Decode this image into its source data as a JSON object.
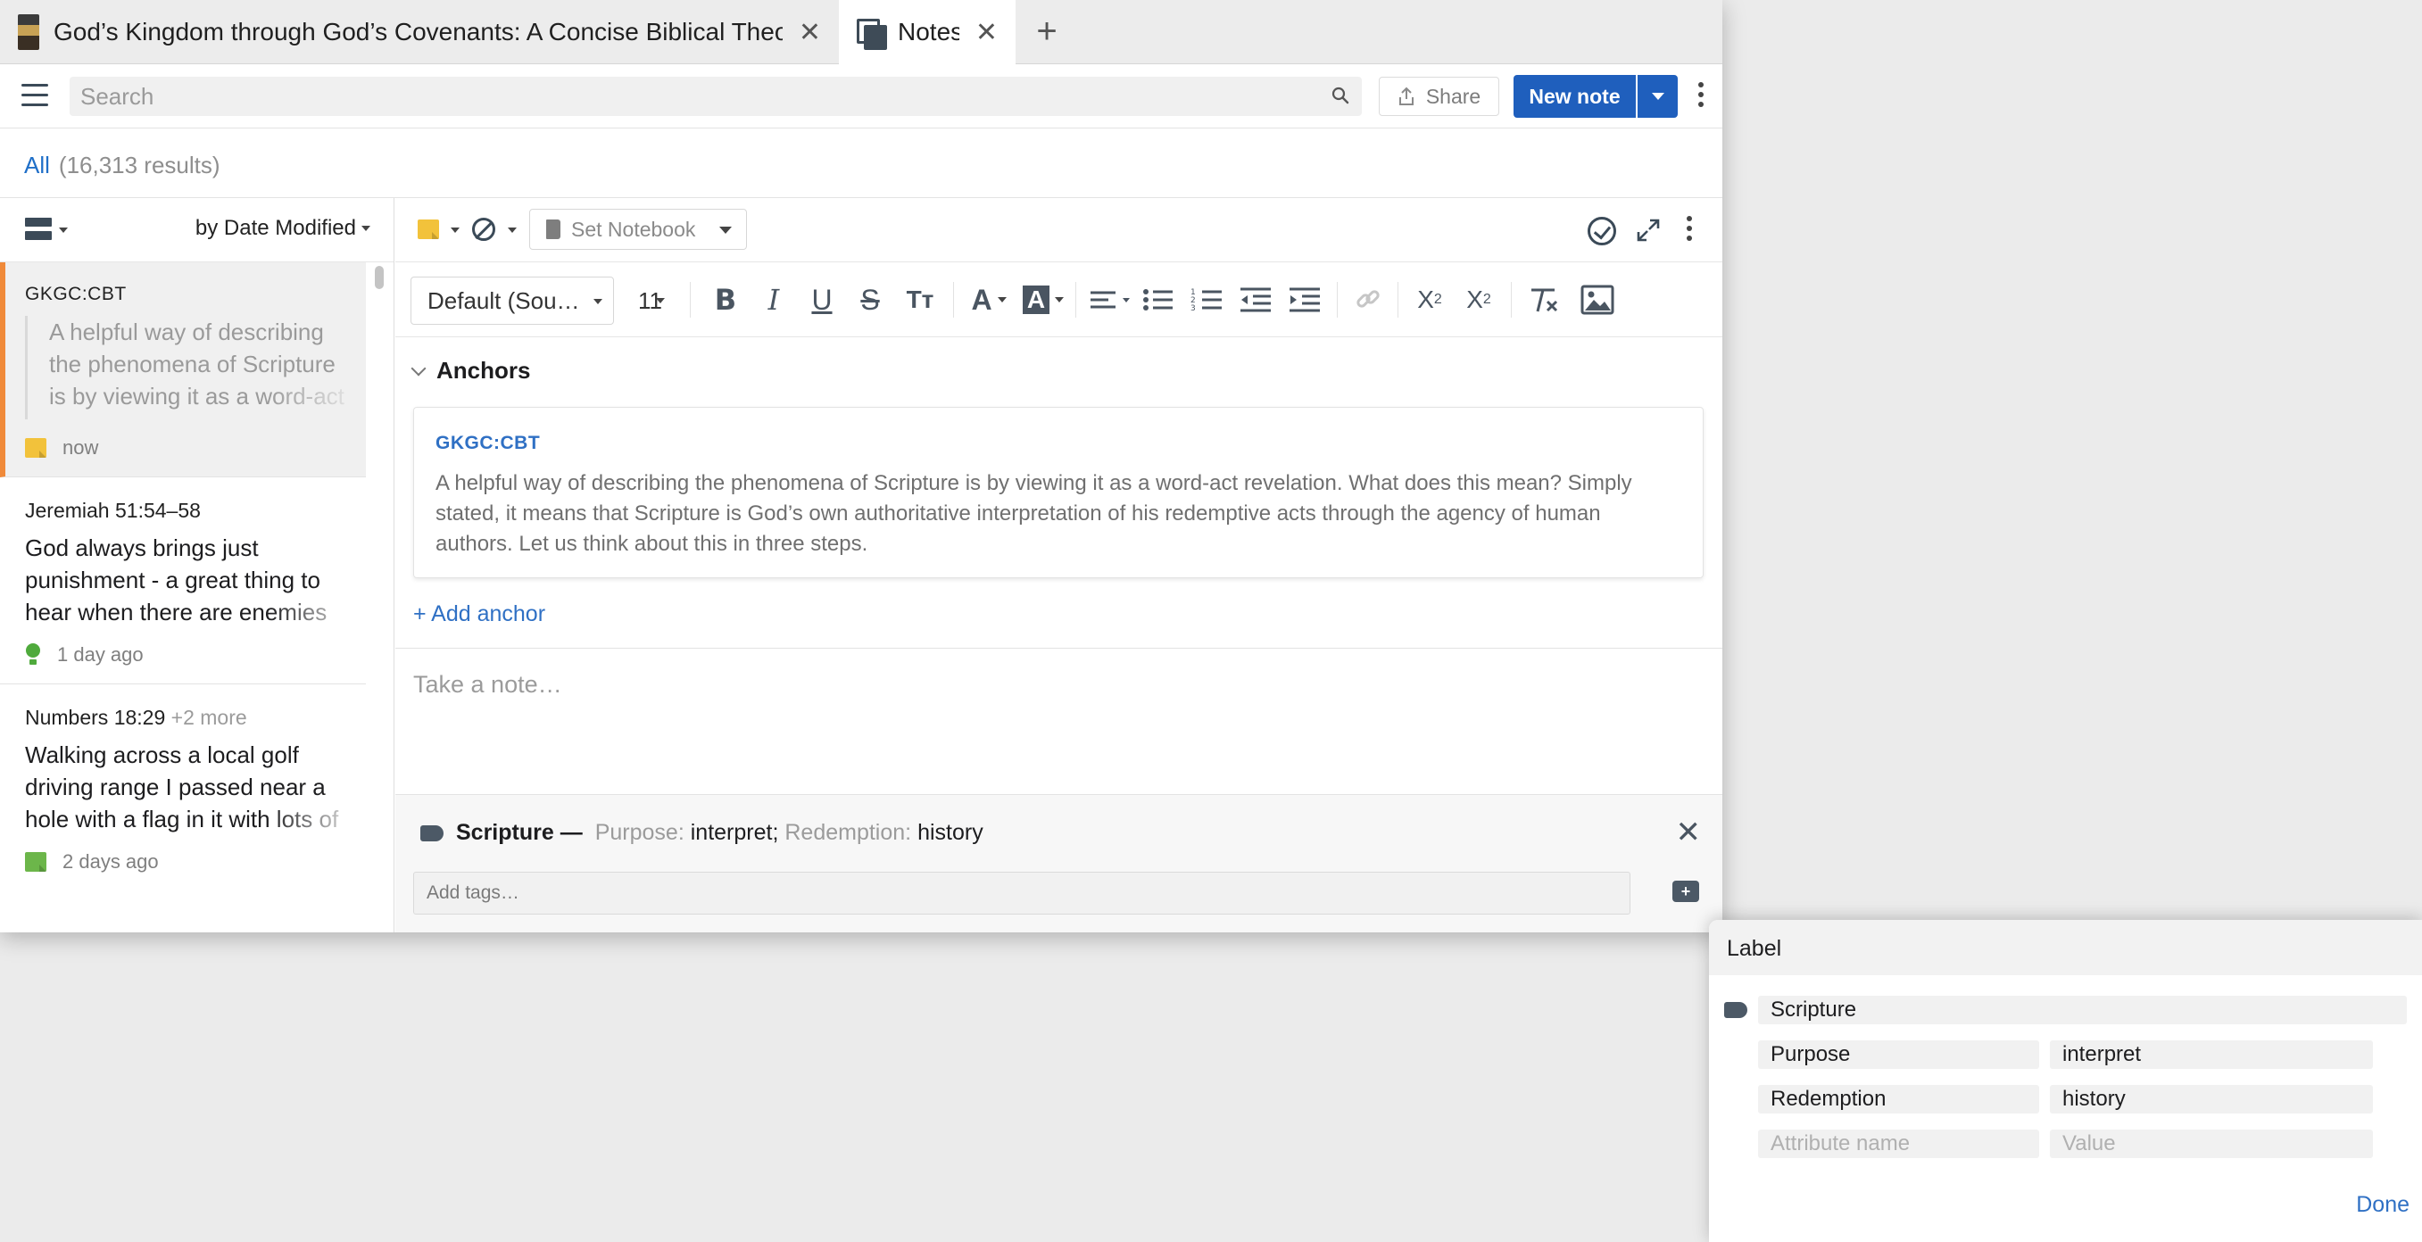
{
  "tabs": [
    {
      "label": "God’s Kingdom through God’s Covenants: A Concise Biblical Theology",
      "close": "✕"
    },
    {
      "label": "Notes",
      "close": "✕"
    }
  ],
  "tab_add": "+",
  "toolbar": {
    "search_placeholder": "Search",
    "share_label": "Share",
    "new_note_label": "New note"
  },
  "results": {
    "filter": "All",
    "count": "(16,313 results)"
  },
  "list": {
    "sort_label": "by Date Modified",
    "items": [
      {
        "ref": "GKGC:CBT",
        "more": "",
        "snippet": "A helpful way of describing the phenomena of Scripture is by viewing it as a word-act revelation.",
        "time": "now"
      },
      {
        "ref": "Jeremiah 51:54–58",
        "more": "",
        "snippet": "God always brings just punishment - a great thing to hear when there are enemies",
        "time": "1 day ago"
      },
      {
        "ref": "Numbers 18:29",
        "more": "+2 more",
        "snippet": "Walking across a local golf driving range I passed near a hole with a flag in it with lots of",
        "time": "2 days ago"
      }
    ]
  },
  "editor": {
    "set_notebook": "Set Notebook",
    "font": "Default (Sou…",
    "size": "11",
    "anchors_heading": "Anchors",
    "anchor": {
      "source": "GKGC:CBT",
      "text": "A helpful way of describing the phenomena of Scripture is by viewing it as a word-act revelation. What does this mean? Simply stated, it means that Scripture is God’s own authoritative interpretation of his redemptive acts through the agency of human authors. Let us think about this in three steps."
    },
    "add_anchor": "+ Add anchor",
    "note_placeholder": "Take a note…",
    "tag": {
      "label": "Scripture",
      "dash": "—",
      "k1": "Purpose:",
      "v1": "interpret;",
      "k2": "Redemption:",
      "v2": "history"
    },
    "add_tags_placeholder": "Add tags…"
  },
  "label_popup": {
    "title": "Label",
    "label_value": "Scripture",
    "attributes": [
      {
        "name": "Purpose",
        "value": "interpret"
      },
      {
        "name": "Redemption",
        "value": "history"
      }
    ],
    "attr_name_placeholder": "Attribute name",
    "attr_value_placeholder": "Value",
    "done": "Done"
  },
  "colors": {
    "accent": "#1f5fbd",
    "link": "#2f70c4",
    "selection_bar": "#f08a3a",
    "sticky_yellow": "#f2c23b",
    "sticky_green": "#6cb64a"
  },
  "icons": [
    "book-cover-icon",
    "notes-icon",
    "close-icon",
    "plus-icon",
    "hamburger-icon",
    "search-icon",
    "share-icon",
    "chevron-down-icon",
    "more-vertical-icon",
    "list-view-icon",
    "sticky-note-icon",
    "lightbulb-icon",
    "no-entry-icon",
    "notebook-icon",
    "check-circle-icon",
    "expand-icon",
    "bold-icon",
    "italic-icon",
    "underline-icon",
    "strikethrough-icon",
    "text-size-icon",
    "font-color-icon",
    "highlight-icon",
    "align-icon",
    "bullet-list-icon",
    "numbered-list-icon",
    "outdent-icon",
    "indent-icon",
    "link-icon",
    "subscript-icon",
    "superscript-icon",
    "clear-format-icon",
    "image-icon",
    "tag-icon",
    "add-tag-icon"
  ]
}
